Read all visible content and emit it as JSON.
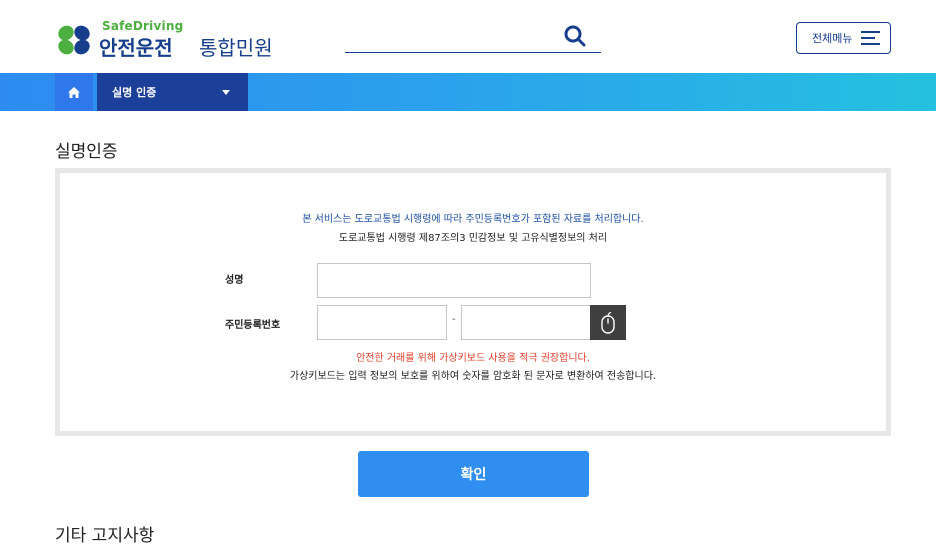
{
  "header": {
    "logo_small": "SafeDriving",
    "logo_main": "안전운전",
    "logo_sub": "통합민원",
    "search_placeholder": "",
    "menu_label": "전체메뉴",
    "brand_green": "#4caf3f",
    "brand_navy": "#173e8c"
  },
  "nav": {
    "home_icon": "home-icon",
    "current": "실명 인증"
  },
  "page": {
    "title": "실명인증",
    "notice_line1": "본 서비스는 도로교통법 시행령에 따라 주민등록번호가 포함된 자료를 처리합니다.",
    "notice_line2": "도로교통법 시행령 제87조의3 민감정보 및 고유식별정보의 처리",
    "name_label": "성명",
    "name_value": "",
    "rrn_label": "주민등록번호",
    "rrn_front": "",
    "rrn_dash": "-",
    "rrn_back": "",
    "keyboard_icon": "mouse-icon",
    "warning": "안전한 거래를 위해 가상키보드 사용을 적극 권장합니다.",
    "info": "가상키보드는 입력 정보의 보호를 위하여 숫자를 암호화 된 문자로 변환하여 전송합니다.",
    "confirm_label": "확인",
    "next_section_title": "기타 고지사항"
  }
}
